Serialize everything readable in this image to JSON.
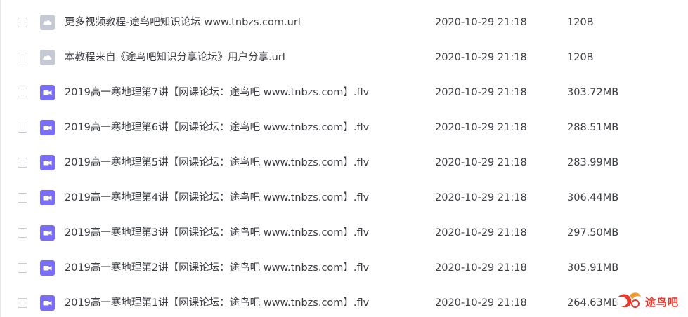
{
  "files": [
    {
      "name": "更多视频教程-途鸟吧知识论坛 www.tnbzs.com.url",
      "date": "2020-10-29 21:18",
      "size": "120B",
      "icon": "url-cloud-icon"
    },
    {
      "name": "本教程来自《途鸟吧知识分享论坛》用户分享.url",
      "date": "2020-10-29 21:18",
      "size": "120B",
      "icon": "url-cloud-icon"
    },
    {
      "name": "2019高一寒地理第7讲【网课论坛：途鸟吧 www.tnbzs.com】.flv",
      "date": "2020-10-29 21:18",
      "size": "303.72MB",
      "icon": "video-file-icon"
    },
    {
      "name": "2019高一寒地理第6讲【网课论坛：途鸟吧 www.tnbzs.com】.flv",
      "date": "2020-10-29 21:18",
      "size": "288.51MB",
      "icon": "video-file-icon"
    },
    {
      "name": "2019高一寒地理第5讲【网课论坛：途鸟吧 www.tnbzs.com】.flv",
      "date": "2020-10-29 21:18",
      "size": "283.99MB",
      "icon": "video-file-icon"
    },
    {
      "name": "2019高一寒地理第4讲【网课论坛：途鸟吧 www.tnbzs.com】.flv",
      "date": "2020-10-29 21:18",
      "size": "306.44MB",
      "icon": "video-file-icon"
    },
    {
      "name": "2019高一寒地理第3讲【网课论坛：途鸟吧 www.tnbzs.com】.flv",
      "date": "2020-10-29 21:18",
      "size": "297.50MB",
      "icon": "video-file-icon"
    },
    {
      "name": "2019高一寒地理第2讲【网课论坛：途鸟吧 www.tnbzs.com】.flv",
      "date": "2020-10-29 21:18",
      "size": "305.91MB",
      "icon": "video-file-icon"
    },
    {
      "name": "2019高一寒地理第1讲【网课论坛：途鸟吧 www.tnbzs.com】.flv",
      "date": "2020-10-29 21:18",
      "size": "264.63MB",
      "icon": "video-file-icon"
    }
  ],
  "watermark": {
    "text": "途鸟吧",
    "color": "#e8392f"
  },
  "colors": {
    "url_icon": "#c4c9d4",
    "video_icon": "#7b6ef6",
    "text": "#3b3d43"
  }
}
